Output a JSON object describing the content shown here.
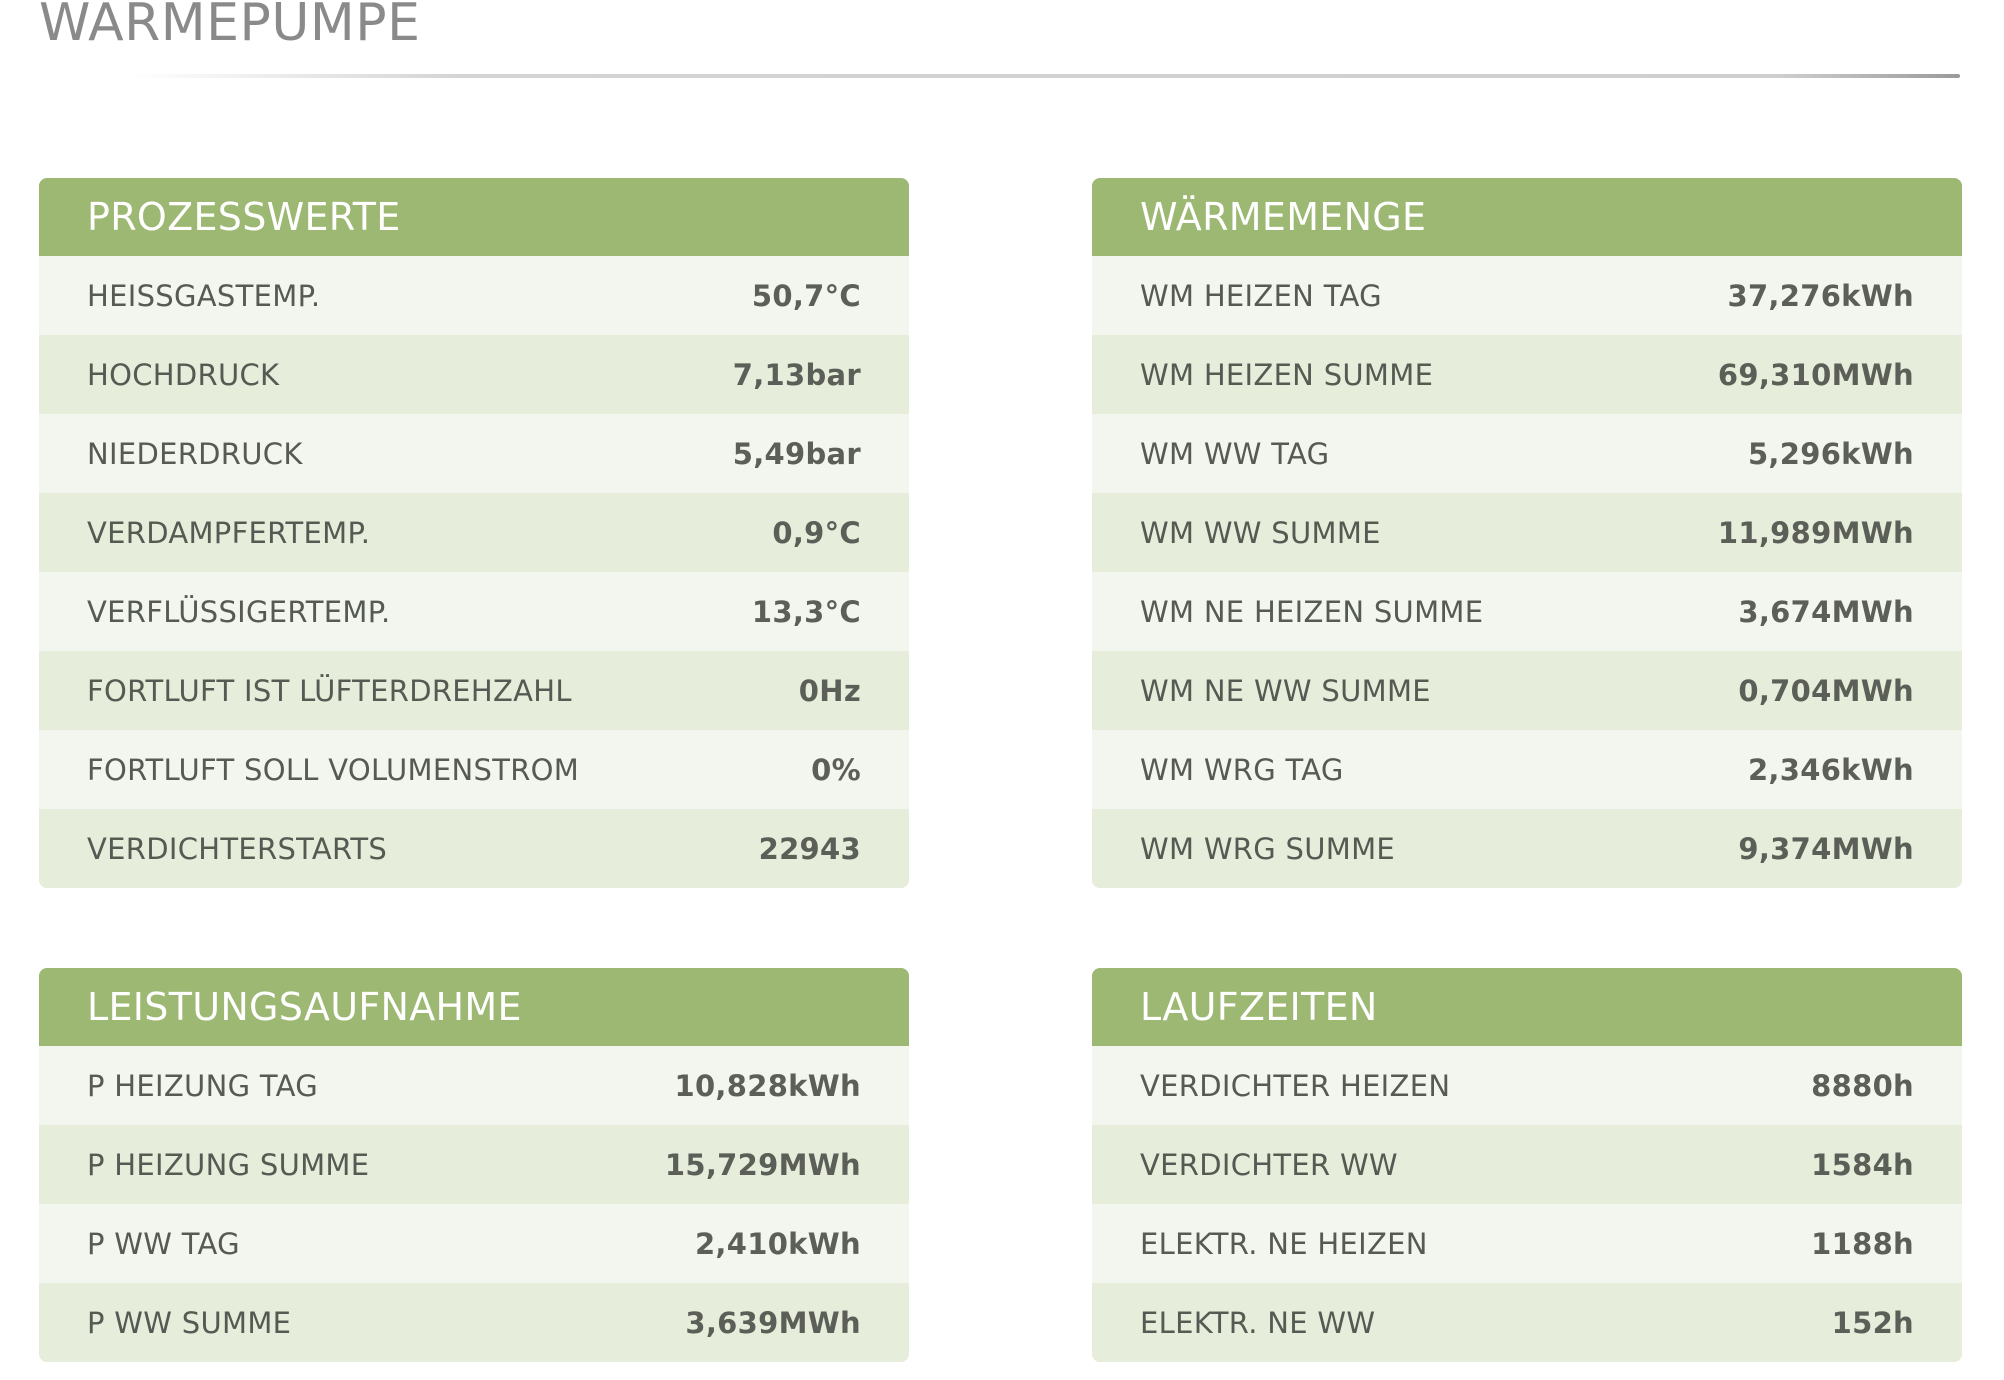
{
  "page": {
    "title": "WÄRMEPUMPE"
  },
  "colors": {
    "header_bg": "#9cb872",
    "row_light": "#f3f6ee",
    "row_dark": "#e6eddb",
    "title_text": "#8a8a8a"
  },
  "panels": [
    {
      "title": "PROZESSWERTE",
      "rows": [
        {
          "label": "HEISSGASTEMP.",
          "value": "50,7°C"
        },
        {
          "label": "HOCHDRUCK",
          "value": "7,13bar"
        },
        {
          "label": "NIEDERDRUCK",
          "value": "5,49bar"
        },
        {
          "label": "VERDAMPFERTEMP.",
          "value": "0,9°C"
        },
        {
          "label": "VERFLÜSSIGERTEMP.",
          "value": "13,3°C"
        },
        {
          "label": "FORTLUFT IST LÜFTERDREHZAHL",
          "value": "0Hz"
        },
        {
          "label": "FORTLUFT SOLL VOLUMENSTROM",
          "value": "0%"
        },
        {
          "label": "VERDICHTERSTARTS",
          "value": "22943"
        }
      ]
    },
    {
      "title": "WÄRMEMENGE",
      "rows": [
        {
          "label": "WM HEIZEN TAG",
          "value": "37,276kWh"
        },
        {
          "label": "WM HEIZEN SUMME",
          "value": "69,310MWh"
        },
        {
          "label": "WM WW TAG",
          "value": "5,296kWh"
        },
        {
          "label": "WM WW SUMME",
          "value": "11,989MWh"
        },
        {
          "label": "WM NE HEIZEN SUMME",
          "value": "3,674MWh"
        },
        {
          "label": "WM NE WW SUMME",
          "value": "0,704MWh"
        },
        {
          "label": "WM WRG TAG",
          "value": "2,346kWh"
        },
        {
          "label": "WM WRG SUMME",
          "value": "9,374MWh"
        }
      ]
    },
    {
      "title": "LEISTUNGSAUFNAHME",
      "rows": [
        {
          "label": "P HEIZUNG TAG",
          "value": "10,828kWh"
        },
        {
          "label": "P HEIZUNG SUMME",
          "value": "15,729MWh"
        },
        {
          "label": "P WW TAG",
          "value": "2,410kWh"
        },
        {
          "label": "P WW SUMME",
          "value": "3,639MWh"
        }
      ]
    },
    {
      "title": "LAUFZEITEN",
      "rows": [
        {
          "label": "VERDICHTER HEIZEN",
          "value": "8880h"
        },
        {
          "label": "VERDICHTER WW",
          "value": "1584h"
        },
        {
          "label": "ELEKTR. NE HEIZEN",
          "value": "1188h"
        },
        {
          "label": "ELEKTR. NE WW",
          "value": "152h"
        }
      ]
    }
  ]
}
